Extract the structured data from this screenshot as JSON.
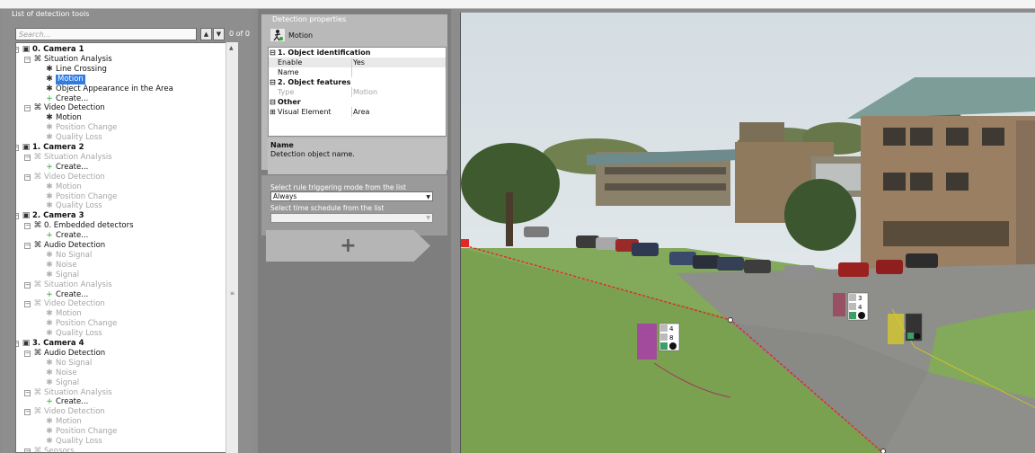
{
  "left_panel": {
    "title": "List of detection tools",
    "search_placeholder": "Search...",
    "search_count": "0 of 0"
  },
  "tree": [
    {
      "label": "0. Camera 1",
      "type": "camera"
    },
    {
      "label": "Situation Analysis",
      "type": "group"
    },
    {
      "label": "Line Crossing",
      "type": "item"
    },
    {
      "label": "Motion",
      "type": "item",
      "selected": true
    },
    {
      "label": "Object Appearance in the Area",
      "type": "item"
    },
    {
      "label": "Create...",
      "type": "create"
    },
    {
      "label": "Video Detection",
      "type": "group"
    },
    {
      "label": "Motion",
      "type": "item"
    },
    {
      "label": "Position Change",
      "type": "item",
      "disabled": true
    },
    {
      "label": "Quality Loss",
      "type": "item",
      "disabled": true
    },
    {
      "label": "1. Camera 2",
      "type": "camera"
    },
    {
      "label": "Situation Analysis",
      "type": "group",
      "disabled": true
    },
    {
      "label": "Create...",
      "type": "create"
    },
    {
      "label": "Video Detection",
      "type": "group",
      "disabled": true
    },
    {
      "label": "Motion",
      "type": "item",
      "disabled": true
    },
    {
      "label": "Position Change",
      "type": "item",
      "disabled": true
    },
    {
      "label": "Quality Loss",
      "type": "item",
      "disabled": true
    },
    {
      "label": "2. Camera 3",
      "type": "camera"
    },
    {
      "label": "0. Embedded detectors",
      "type": "group"
    },
    {
      "label": "Create...",
      "type": "create"
    },
    {
      "label": "Audio Detection",
      "type": "group"
    },
    {
      "label": "No Signal",
      "type": "item",
      "disabled": true
    },
    {
      "label": "Noise",
      "type": "item",
      "disabled": true
    },
    {
      "label": "Signal",
      "type": "item",
      "disabled": true
    },
    {
      "label": "Situation Analysis",
      "type": "group",
      "disabled": true
    },
    {
      "label": "Create...",
      "type": "create"
    },
    {
      "label": "Video Detection",
      "type": "group",
      "disabled": true
    },
    {
      "label": "Motion",
      "type": "item",
      "disabled": true
    },
    {
      "label": "Position Change",
      "type": "item",
      "disabled": true
    },
    {
      "label": "Quality Loss",
      "type": "item",
      "disabled": true
    },
    {
      "label": "3. Camera 4",
      "type": "camera"
    },
    {
      "label": "Audio Detection",
      "type": "group"
    },
    {
      "label": "No Signal",
      "type": "item",
      "disabled": true
    },
    {
      "label": "Noise",
      "type": "item",
      "disabled": true
    },
    {
      "label": "Signal",
      "type": "item",
      "disabled": true
    },
    {
      "label": "Situation Analysis",
      "type": "group",
      "disabled": true
    },
    {
      "label": "Create...",
      "type": "create"
    },
    {
      "label": "Video Detection",
      "type": "group",
      "disabled": true
    },
    {
      "label": "Motion",
      "type": "item",
      "disabled": true
    },
    {
      "label": "Position Change",
      "type": "item",
      "disabled": true
    },
    {
      "label": "Quality Loss",
      "type": "item",
      "disabled": true
    },
    {
      "label": "Sensors",
      "type": "group",
      "disabled": true
    }
  ],
  "properties": {
    "title": "Detection properties",
    "header": "Motion",
    "rows": [
      {
        "kind": "section",
        "sign": "⊟",
        "key": "1. Object identification"
      },
      {
        "kind": "row",
        "key": "Enable",
        "value": "Yes"
      },
      {
        "kind": "row",
        "key": "Name",
        "value": ""
      },
      {
        "kind": "section",
        "sign": "⊟",
        "key": "2. Object features"
      },
      {
        "kind": "row",
        "key": "Type",
        "value": "Motion",
        "dim": true
      },
      {
        "kind": "section",
        "sign": "⊟",
        "key": "Other"
      },
      {
        "kind": "row",
        "key": "Visual Element",
        "value": "Area",
        "sign": "⊞"
      }
    ],
    "desc_title": "Name",
    "desc_text": "Detection object name."
  },
  "rules": {
    "trigger_label": "Select rule triggering mode from the list",
    "trigger_value": "Always",
    "schedule_label": "Select time schedule from the list",
    "schedule_value": "",
    "add_label": "+"
  },
  "camera": {
    "tracks": [
      {
        "id_a": "4",
        "id_b": "8",
        "color": "#b02fb7"
      },
      {
        "id_a": "3",
        "id_b": "4",
        "color": "#9e3b57"
      },
      {
        "id_a": "",
        "id_b": "",
        "color": "#d4c92d"
      }
    ],
    "zone_color": "#e3262a"
  }
}
